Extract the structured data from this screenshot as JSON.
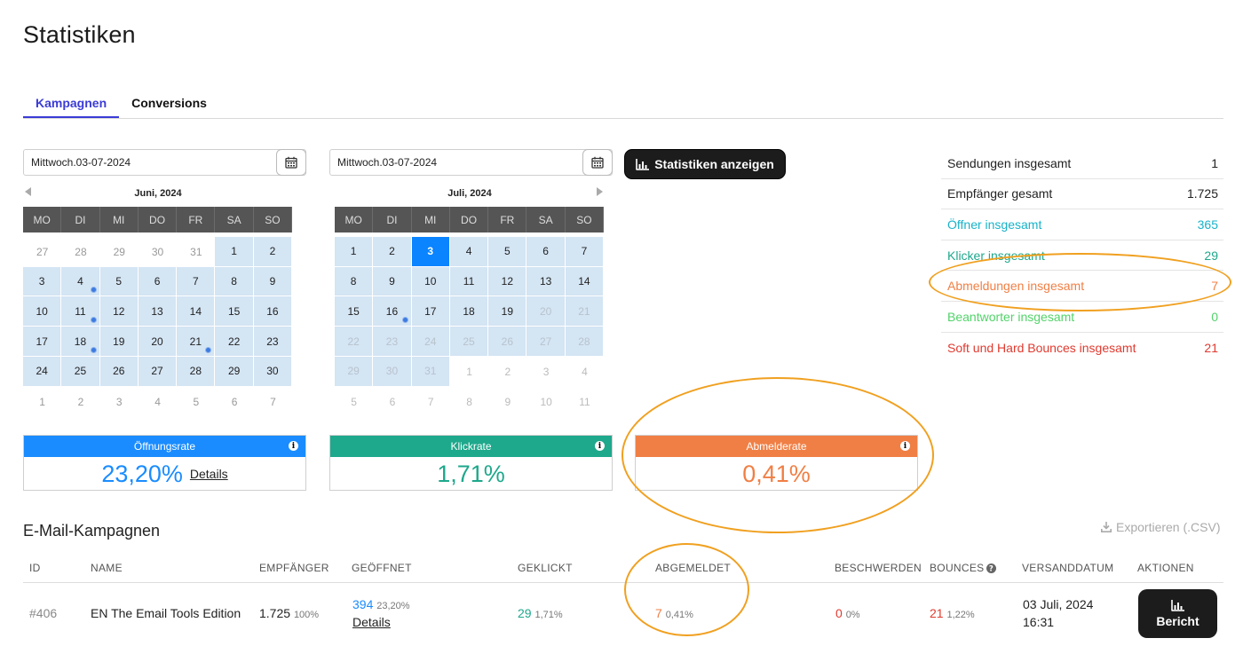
{
  "page": {
    "title": "Statistiken"
  },
  "tabs": [
    {
      "label": "Kampagnen",
      "active": true
    },
    {
      "label": "Conversions",
      "active": false
    }
  ],
  "filters": {
    "start_date": "Mittwoch.03-07-2024",
    "end_date": "Mittwoch.03-07-2024",
    "show_button": "Statistiken anzeigen"
  },
  "calendars": {
    "weekdays": [
      "MO",
      "DI",
      "MI",
      "DO",
      "FR",
      "SA",
      "SO"
    ],
    "left": {
      "title": "Juni, 2024",
      "days": [
        [
          "27",
          "out"
        ],
        [
          "28",
          "out"
        ],
        [
          "29",
          "out"
        ],
        [
          "30",
          "out"
        ],
        [
          "31",
          "out"
        ],
        [
          "1",
          "in"
        ],
        [
          "2",
          "in"
        ],
        [
          "3",
          "in"
        ],
        [
          "4",
          "in",
          "dot"
        ],
        [
          "5",
          "in"
        ],
        [
          "6",
          "in"
        ],
        [
          "7",
          "in"
        ],
        [
          "8",
          "in"
        ],
        [
          "9",
          "in"
        ],
        [
          "10",
          "in"
        ],
        [
          "11",
          "in",
          "dot"
        ],
        [
          "12",
          "in"
        ],
        [
          "13",
          "in"
        ],
        [
          "14",
          "in"
        ],
        [
          "15",
          "in"
        ],
        [
          "16",
          "in"
        ],
        [
          "17",
          "in"
        ],
        [
          "18",
          "in",
          "dot"
        ],
        [
          "19",
          "in"
        ],
        [
          "20",
          "in"
        ],
        [
          "21",
          "in",
          "dot"
        ],
        [
          "22",
          "in"
        ],
        [
          "23",
          "in"
        ],
        [
          "24",
          "in"
        ],
        [
          "25",
          "in"
        ],
        [
          "26",
          "in"
        ],
        [
          "27",
          "in"
        ],
        [
          "28",
          "in"
        ],
        [
          "29",
          "in"
        ],
        [
          "30",
          "in"
        ],
        [
          "1",
          "out"
        ],
        [
          "2",
          "out"
        ],
        [
          "3",
          "out"
        ],
        [
          "4",
          "out"
        ],
        [
          "5",
          "out"
        ],
        [
          "6",
          "out"
        ],
        [
          "7",
          "out"
        ]
      ]
    },
    "right": {
      "title": "Juli, 2024",
      "days": [
        [
          "1",
          "in"
        ],
        [
          "2",
          "in"
        ],
        [
          "3",
          "sel"
        ],
        [
          "4",
          "in"
        ],
        [
          "5",
          "in"
        ],
        [
          "6",
          "in"
        ],
        [
          "7",
          "in"
        ],
        [
          "8",
          "in"
        ],
        [
          "9",
          "in"
        ],
        [
          "10",
          "in"
        ],
        [
          "11",
          "in"
        ],
        [
          "12",
          "in"
        ],
        [
          "13",
          "in"
        ],
        [
          "14",
          "in"
        ],
        [
          "15",
          "in"
        ],
        [
          "16",
          "in",
          "dot"
        ],
        [
          "17",
          "in"
        ],
        [
          "18",
          "in"
        ],
        [
          "19",
          "in"
        ],
        [
          "20",
          "dis"
        ],
        [
          "21",
          "dis"
        ],
        [
          "22",
          "dis"
        ],
        [
          "23",
          "dis"
        ],
        [
          "24",
          "dis"
        ],
        [
          "25",
          "dis"
        ],
        [
          "26",
          "dis"
        ],
        [
          "27",
          "dis"
        ],
        [
          "28",
          "dis"
        ],
        [
          "29",
          "dis"
        ],
        [
          "30",
          "dis"
        ],
        [
          "31",
          "dis"
        ],
        [
          "1",
          "dis-plain"
        ],
        [
          "2",
          "dis-plain"
        ],
        [
          "3",
          "dis-plain"
        ],
        [
          "4",
          "dis-plain"
        ],
        [
          "5",
          "dis-plain"
        ],
        [
          "6",
          "dis-plain"
        ],
        [
          "7",
          "dis-plain"
        ],
        [
          "8",
          "dis-plain"
        ],
        [
          "9",
          "dis-plain"
        ],
        [
          "10",
          "dis-plain"
        ],
        [
          "11",
          "dis-plain"
        ]
      ]
    }
  },
  "rates": {
    "open": {
      "label": "Öffnungsrate",
      "value": "23,20%",
      "details": "Details",
      "color": "#1a8cff"
    },
    "click": {
      "label": "Klickrate",
      "value": "1,71%",
      "color": "#1ea88c"
    },
    "unsub": {
      "label": "Abmelderate",
      "value": "0,41%",
      "color": "#f07f45"
    }
  },
  "stats": [
    {
      "label": "Sendungen insgesamt",
      "value": "1",
      "color": "#222222"
    },
    {
      "label": "Empfänger gesamt",
      "value": "1.725",
      "color": "#222222"
    },
    {
      "label": "Öffner insgesamt",
      "value": "365",
      "color": "#17b3c9"
    },
    {
      "label": "Klicker insgesamt",
      "value": "29",
      "color": "#1ea88c"
    },
    {
      "label": "Abmeldungen insgesamt",
      "value": "7",
      "color": "#f07f45"
    },
    {
      "label": "Beantworter insgesamt",
      "value": "0",
      "color": "#52d36a"
    },
    {
      "label": "Soft und Hard Bounces insgesamt",
      "value": "21",
      "color": "#e03a2f"
    }
  ],
  "campaigns": {
    "title": "E-Mail-Kampagnen",
    "export_label": "Exportieren (.CSV)",
    "headers": {
      "id": "ID",
      "name": "NAME",
      "recipients": "EMPFÄNGER",
      "opened": "GEÖFFNET",
      "clicked": "GEKLICKT",
      "unsubscribed": "ABGEMELDET",
      "complaints": "BESCHWERDEN",
      "bounces": "BOUNCES",
      "sent_date": "VERSANDDATUM",
      "actions": "AKTIONEN"
    },
    "row": {
      "id": "#406",
      "name": "EN The Email Tools Edition",
      "recipients": "1.725",
      "recipients_pct": "100%",
      "opened": "394",
      "opened_pct": "23,20%",
      "opened_details": "Details",
      "clicked": "29",
      "clicked_pct": "1,71%",
      "unsubscribed": "7",
      "unsubscribed_pct": "0,41%",
      "complaints": "0",
      "complaints_pct": "0%",
      "bounces": "21",
      "bounces_pct": "1,22%",
      "sent_date": "03 Juli, 2024",
      "sent_time": "16:31",
      "report_button": "Bericht"
    }
  }
}
